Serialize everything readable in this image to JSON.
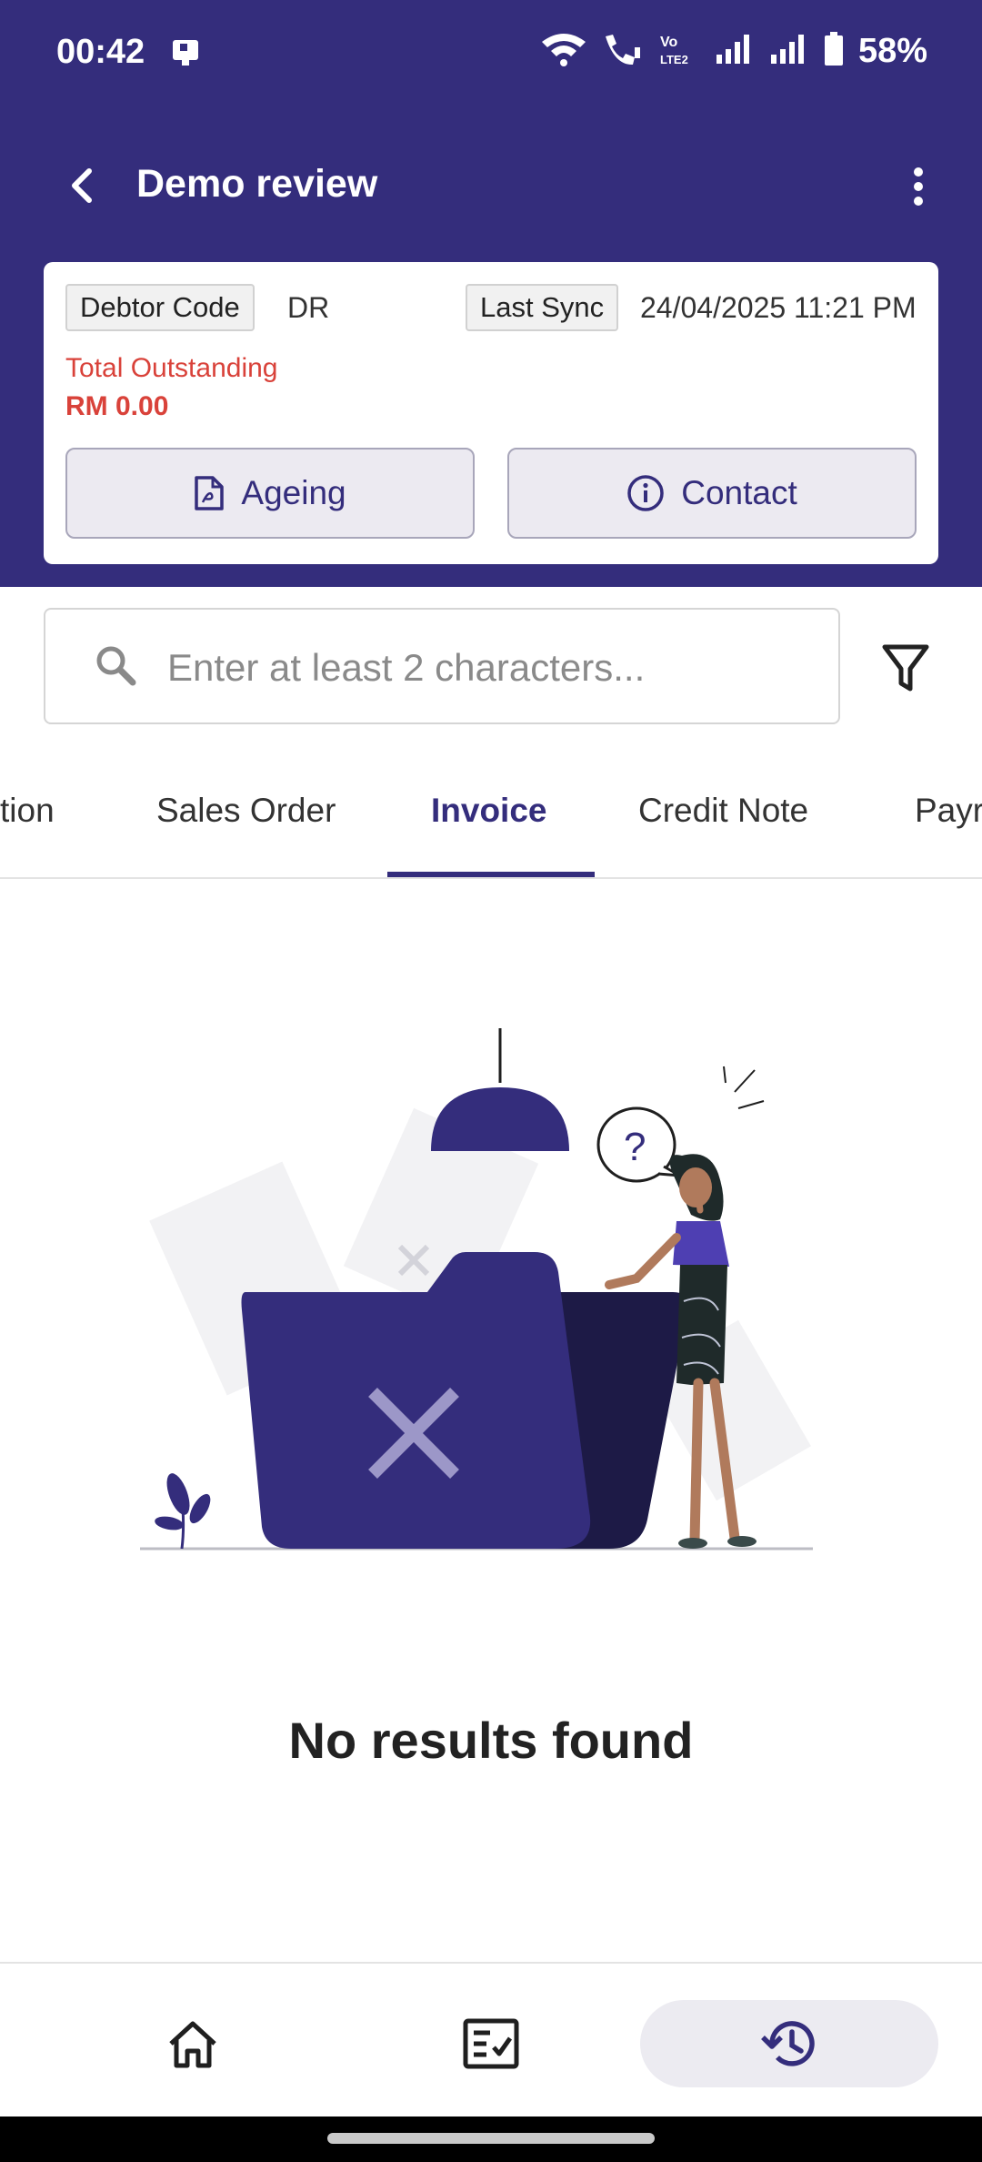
{
  "status_bar": {
    "time": "00:42",
    "battery": "58%",
    "icons": [
      "nfc-icon",
      "wifi-icon",
      "wifi-call-icon",
      "volte-icon",
      "signal-icon",
      "signal-icon",
      "battery-icon"
    ]
  },
  "appbar": {
    "title": "Demo review",
    "back_icon": "back-arrow-icon",
    "menu_icon": "more-vertical-icon"
  },
  "summary": {
    "debtor_code_label": "Debtor Code",
    "debtor_code_value": "DR",
    "last_sync_label": "Last Sync",
    "last_sync_value": "24/04/2025 11:21 PM",
    "total_outstanding_label": "Total Outstanding",
    "total_outstanding_value": "RM 0.00",
    "ageing_label": "Ageing",
    "contact_label": "Contact"
  },
  "search": {
    "placeholder": "Enter at least 2 characters..."
  },
  "tabs": [
    {
      "label": "tion"
    },
    {
      "label": "Sales Order"
    },
    {
      "label": "Invoice",
      "active": true
    },
    {
      "label": "Credit Note"
    },
    {
      "label": "Payr"
    }
  ],
  "empty_state": {
    "message": "No results found"
  },
  "bottom_nav": [
    {
      "icon": "home-icon"
    },
    {
      "icon": "checklist-icon"
    },
    {
      "icon": "history-icon",
      "active": true
    }
  ],
  "colors": {
    "primary": "#342d7c",
    "danger": "#d9423a"
  }
}
